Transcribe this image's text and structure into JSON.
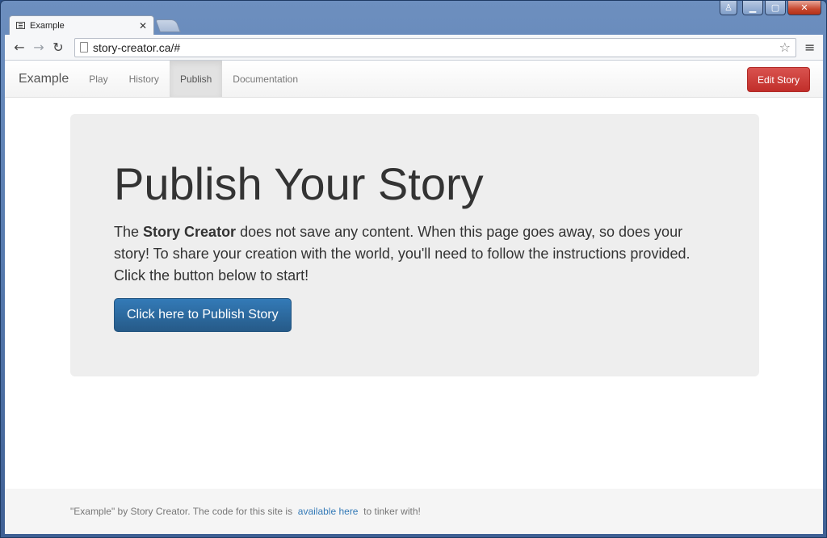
{
  "window": {
    "controls": {
      "profile": "♙",
      "minimize": "▁",
      "maximize": "▢",
      "close": "✕"
    }
  },
  "browser": {
    "tab_title": "Example",
    "tab_close": "✕",
    "back_icon": "←",
    "forward_icon": "→",
    "reload_icon": "↻",
    "url": "story-creator.ca/#",
    "star_icon": "☆",
    "menu_icon": "≡"
  },
  "navbar": {
    "brand": "Example",
    "links": [
      {
        "label": "Play",
        "active": false
      },
      {
        "label": "History",
        "active": false
      },
      {
        "label": "Publish",
        "active": true
      },
      {
        "label": "Documentation",
        "active": false
      }
    ],
    "edit_button": "Edit Story"
  },
  "jumbotron": {
    "heading": "Publish Your Story",
    "text_before": "The ",
    "text_bold": "Story Creator",
    "text_after": " does not save any content. When this page goes away, so does your story! To share your creation with the world, you'll need to follow the instructions provided. Click the button below to start!",
    "button": "Click here to Publish Story"
  },
  "footer": {
    "text_before": "\"Example\" by Story Creator. The code for this site is ",
    "link": "available here",
    "text_after": " to tinker with!"
  },
  "colors": {
    "primary": "#337ab7",
    "danger": "#d9534f",
    "jumbotron_bg": "#eeeeee"
  }
}
